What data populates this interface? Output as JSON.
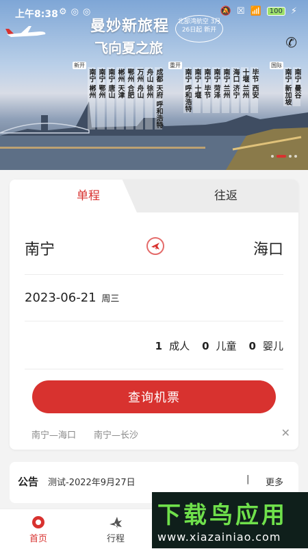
{
  "status_bar": {
    "time": "上午8:38",
    "battery": "100"
  },
  "banner": {
    "headline": "曼妙新旅程",
    "headline_big_char": "新",
    "subline": "飞向夏之旅",
    "stamp_text": "北部湾航空 3月26日起 新开",
    "tags": [
      "新开",
      "重开",
      "国际"
    ],
    "routes": [
      "南宁 郴州",
      "南宁 鄂州",
      "南宁 唐山",
      "郴州 天津",
      "鄂州 合肥",
      "万州 舟山",
      "舟山 徐州",
      "成都 天府 呼和浩特",
      "南宁 呼和浩特",
      "南宁 十堰",
      "南宁 毕节",
      "南宁 菏泽",
      "南宁 兰州",
      "海口 济宁",
      "十堰 兰州",
      "毕节 西安",
      "南宁 新加坡",
      "南宁 曼谷"
    ]
  },
  "booking": {
    "tab_oneway": "单程",
    "tab_round": "往返",
    "from_city": "南宁",
    "to_city": "海口",
    "date": "2023-06-21",
    "weekday": "周三",
    "adults_count": "1",
    "adults_label": "成人",
    "children_count": "0",
    "children_label": "儿童",
    "infants_count": "0",
    "infants_label": "婴儿",
    "search_label": "查询机票",
    "history": [
      "南宁—海口",
      "南宁—长沙"
    ]
  },
  "notice": {
    "tag": "公告",
    "text": "测试-2022年9月27日",
    "separator": "|",
    "more": "更多"
  },
  "tabbar": {
    "home": "首页",
    "trip": "行程"
  },
  "watermark": {
    "title": "下载鸟应用",
    "url": "www.xiazainiao.com"
  },
  "colors": {
    "accent": "#d8322f",
    "tab_inactive_bg": "#ececec"
  }
}
